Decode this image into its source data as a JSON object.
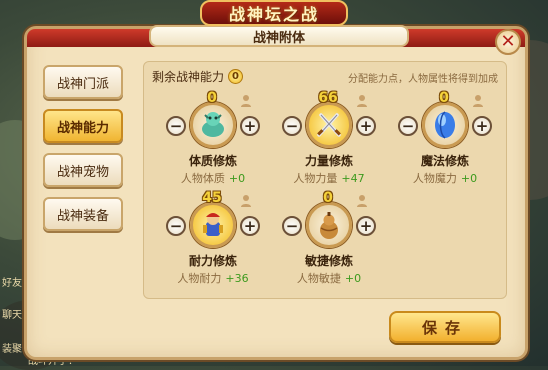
{
  "game_title": "战神坛之战",
  "panel_title": "战神附体",
  "tabs": [
    {
      "label": "战神门派",
      "active": false
    },
    {
      "label": "战神能力",
      "active": true
    },
    {
      "label": "战神宠物",
      "active": false
    },
    {
      "label": "战神装备",
      "active": false
    }
  ],
  "remaining_label": "剩余战神能力",
  "remaining_points": "0",
  "hint": "分配能力点，人物属性将得到加成",
  "attributes": [
    {
      "points": "0",
      "name": "体质修炼",
      "stat_label": "人物体质",
      "bonus": "+0",
      "icon": "jade-beast-icon"
    },
    {
      "points": "66",
      "name": "力量修炼",
      "stat_label": "人物力量",
      "bonus": "+47",
      "icon": "crossed-swords-icon"
    },
    {
      "points": "0",
      "name": "魔法修炼",
      "stat_label": "人物魔力",
      "bonus": "+0",
      "icon": "blue-gem-icon"
    },
    {
      "points": "45",
      "name": "耐力修炼",
      "stat_label": "人物耐力",
      "bonus": "+36",
      "icon": "armored-warrior-icon"
    },
    {
      "points": "0",
      "name": "敏捷修炼",
      "stat_label": "人物敏捷",
      "bonus": "+0",
      "icon": "gourd-icon"
    }
  ],
  "save_label": "保存",
  "left_texts": [
    "好友",
    "聊天",
    "装聚",
    "战斗开了！"
  ],
  "colors": {
    "accent": "#f0b532",
    "panel": "#f3e2bd",
    "bonus": "#3d9a1e",
    "close": "#b3231a"
  }
}
